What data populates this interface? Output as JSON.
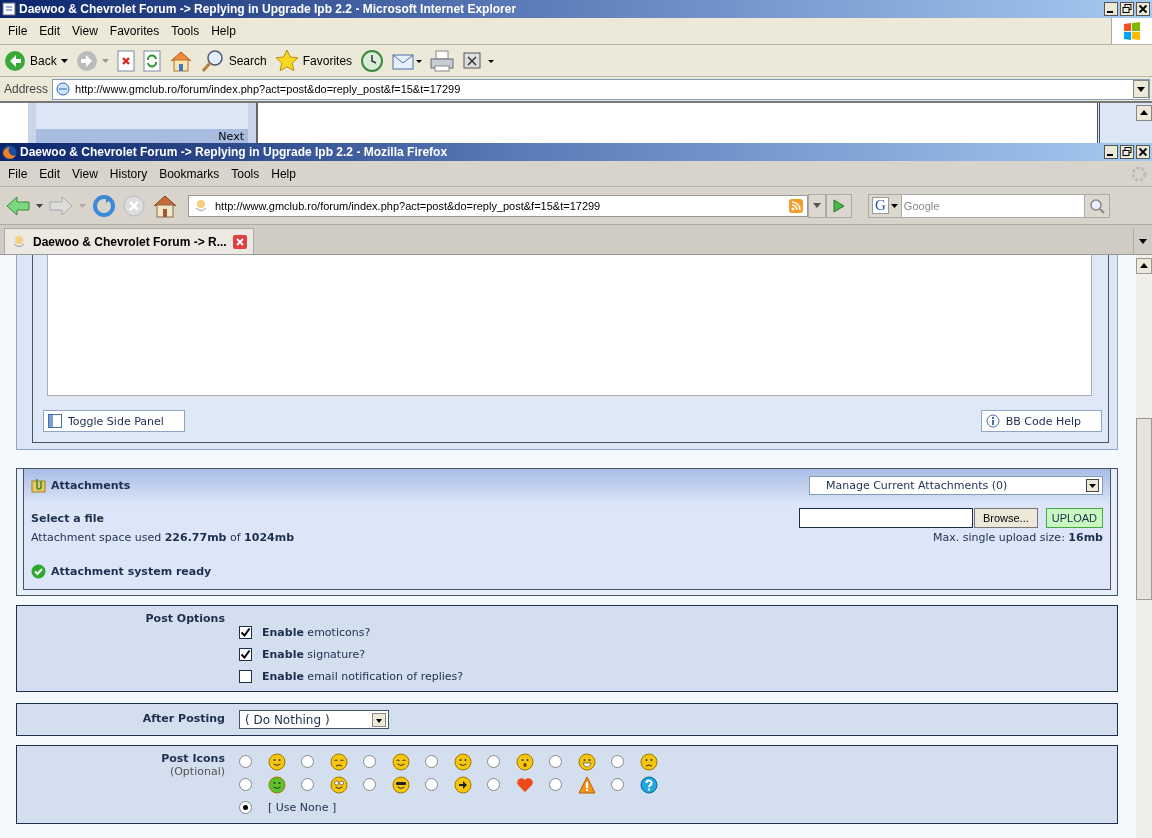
{
  "ie": {
    "title": "Daewoo & Chevrolet Forum -> Replying in Upgrade Ipb 2.2 - Microsoft Internet Explorer",
    "menu": [
      "File",
      "Edit",
      "View",
      "Favorites",
      "Tools",
      "Help"
    ],
    "toolbar": [
      {
        "kind": "back",
        "label": "Back"
      },
      {
        "kind": "forward"
      },
      {
        "kind": "stop"
      },
      {
        "kind": "refresh"
      },
      {
        "kind": "home"
      },
      {
        "kind": "search",
        "label": "Search"
      },
      {
        "kind": "favorites",
        "label": "Favorites"
      },
      {
        "kind": "history"
      },
      {
        "kind": "mail"
      },
      {
        "kind": "print"
      },
      {
        "kind": "edit"
      }
    ],
    "address_label": "Address",
    "address": "http://www.gmclub.ro/forum/index.php?act=post&do=reply_post&f=15&t=17299",
    "behind_link": "Next"
  },
  "firefox": {
    "title": "Daewoo & Chevrolet Forum -> Replying in Upgrade Ipb 2.2 - Mozilla Firefox",
    "menu": [
      "File",
      "Edit",
      "View",
      "History",
      "Bookmarks",
      "Tools",
      "Help"
    ],
    "address": "http://www.gmclub.ro/forum/index.php?act=post&do=reply_post&f=15&t=17299",
    "engine_logo": "G",
    "search_placeholder": "Google",
    "tab": "Daewoo & Chevrolet Forum -> R..."
  },
  "editor": {
    "buttons": [
      {
        "kind": "panel",
        "label": "Toggle Side Panel"
      },
      {
        "kind": "help",
        "label": "BB Code Help"
      }
    ]
  },
  "attachments": {
    "title": "Attachments",
    "manage": "Manage Current Attachments (0)",
    "select_label": "Select a file",
    "browse": "Browse...",
    "upload": "UPLOAD",
    "space": "Attachment space used **226.77mb** of **1024mb**",
    "max_size": "Max. single upload size: **16mb**",
    "status": "Attachment system ready"
  },
  "post_options": {
    "label": "Post Options",
    "options": [
      {
        "text": "**Enable** emoticons?",
        "checked": true
      },
      {
        "text": "**Enable** signature?",
        "checked": true
      },
      {
        "text": "**Enable** email notification of replies?",
        "checked": false
      }
    ]
  },
  "after_posting": {
    "label": "After Posting",
    "value": "( Do Nothing )"
  },
  "post_icons": {
    "label": "Post Icons",
    "sublabel": "(Optional)",
    "icons": [
      {
        "kind": "smile",
        "selected": false
      },
      {
        "kind": "frown",
        "selected": false
      },
      {
        "kind": "sleepy",
        "selected": false
      },
      {
        "kind": "tongue",
        "selected": false
      },
      {
        "kind": "surprised",
        "selected": false
      },
      {
        "kind": "grin",
        "selected": false
      },
      {
        "kind": "angry",
        "selected": false
      },
      {
        "kind": "sick",
        "selected": false
      },
      {
        "kind": "rolleyes",
        "selected": false
      },
      {
        "kind": "cool",
        "selected": false
      },
      {
        "kind": "arrow",
        "selected": false
      },
      {
        "kind": "heart",
        "selected": false
      },
      {
        "kind": "alert",
        "selected": false
      },
      {
        "kind": "question",
        "selected": false
      }
    ],
    "none": {
      "label": "[ Use None ]",
      "selected": true
    }
  }
}
